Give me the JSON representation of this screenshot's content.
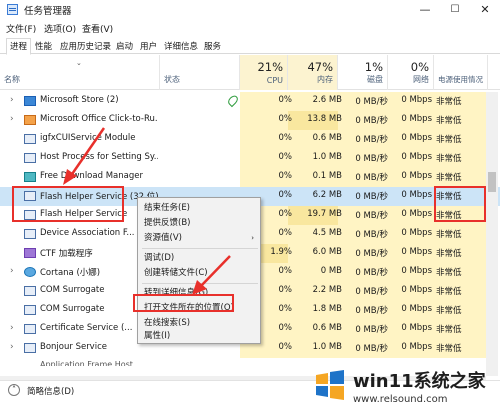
{
  "window": {
    "title": "任务管理器",
    "minimize": "—",
    "maximize": "☐",
    "close": "✕"
  },
  "menubar": [
    "文件(F)",
    "选项(O)",
    "查看(V)"
  ],
  "tabs": [
    "进程",
    "性能",
    "应用历史记录",
    "启动",
    "用户",
    "详细信息",
    "服务"
  ],
  "columns": {
    "name": "名称",
    "status": "状态",
    "cpu": {
      "pct": "21%",
      "label": "CPU"
    },
    "memory": {
      "pct": "47%",
      "label": "内存"
    },
    "disk": {
      "pct": "1%",
      "label": "磁盘"
    },
    "network": {
      "pct": "0%",
      "label": "网络"
    },
    "power": {
      "label": "电源使用情况"
    }
  },
  "rows": [
    {
      "name": "Microsoft Store (2)",
      "cpu": "0%",
      "mem": "2.6 MB",
      "disk": "0 MB/秒",
      "net": "0 Mbps",
      "power": "非常低",
      "expand": "›",
      "icon": "store-icon",
      "leaf": true
    },
    {
      "name": "Microsoft Office Click-to-Ru...",
      "cpu": "0%",
      "mem": "13.8 MB",
      "disk": "0 MB/秒",
      "net": "0 Mbps",
      "power": "非常低",
      "expand": "›",
      "icon": "office-icon"
    },
    {
      "name": "igfxCUIService Module",
      "cpu": "0%",
      "mem": "0.6 MB",
      "disk": "0 MB/秒",
      "net": "0 Mbps",
      "power": "非常低",
      "expand": "",
      "icon": "service-icon"
    },
    {
      "name": "Host Process for Setting Sy...",
      "cpu": "0%",
      "mem": "1.0 MB",
      "disk": "0 MB/秒",
      "net": "0 Mbps",
      "power": "非常低",
      "expand": "",
      "icon": "service-icon"
    },
    {
      "name": "Free Download Manager",
      "cpu": "0%",
      "mem": "0.1 MB",
      "disk": "0 MB/秒",
      "net": "0 Mbps",
      "power": "非常低",
      "expand": "",
      "icon": "download-icon"
    },
    {
      "name": "Flash Helper Service (32 位)",
      "cpu": "0%",
      "mem": "6.2 MB",
      "disk": "0 MB/秒",
      "net": "0 Mbps",
      "power": "非常低",
      "expand": "",
      "icon": "service-icon",
      "selected": true
    },
    {
      "name": "Flash Helper Service",
      "cpu": "0%",
      "mem": "19.7 MB",
      "disk": "0 MB/秒",
      "net": "0 Mbps",
      "power": "非常低",
      "expand": "",
      "icon": "service-icon"
    },
    {
      "name": "Device Association F...",
      "cpu": "0%",
      "mem": "4.5 MB",
      "disk": "0 MB/秒",
      "net": "0 Mbps",
      "power": "非常低",
      "expand": "",
      "icon": "service-icon"
    },
    {
      "name": "CTF 加载程序",
      "cpu": "1.9%",
      "mem": "6.0 MB",
      "disk": "0 MB/秒",
      "net": "0 Mbps",
      "power": "非常低",
      "expand": "",
      "icon": "ctf-icon"
    },
    {
      "name": "Cortana (小娜)",
      "cpu": "0%",
      "mem": "0 MB",
      "disk": "0 MB/秒",
      "net": "0 Mbps",
      "power": "非常低",
      "expand": "›",
      "icon": "cortana-icon"
    },
    {
      "name": "COM Surrogate",
      "cpu": "0%",
      "mem": "2.2 MB",
      "disk": "0 MB/秒",
      "net": "0 Mbps",
      "power": "非常低",
      "expand": "",
      "icon": "service-icon"
    },
    {
      "name": "COM Surrogate",
      "cpu": "0%",
      "mem": "1.8 MB",
      "disk": "0 MB/秒",
      "net": "0 Mbps",
      "power": "非常低",
      "expand": "",
      "icon": "service-icon"
    },
    {
      "name": "Certificate Service (...",
      "cpu": "0%",
      "mem": "0.6 MB",
      "disk": "0 MB/秒",
      "net": "0 Mbps",
      "power": "非常低",
      "expand": "›",
      "icon": "service-icon"
    },
    {
      "name": "Bonjour Service",
      "cpu": "0%",
      "mem": "1.0 MB",
      "disk": "0 MB/秒",
      "net": "0 Mbps",
      "power": "非常低",
      "expand": "›",
      "icon": "service-icon"
    }
  ],
  "context_menu": {
    "items": [
      {
        "label": "结束任务(E)"
      },
      {
        "label": "提供反馈(B)"
      },
      {
        "label": "资源值(V)",
        "submenu": "›"
      },
      {
        "label": "调试(D)"
      },
      {
        "label": "创建转储文件(C)"
      },
      {
        "label": "转到详细信息(G)"
      },
      {
        "label": "打开文件所在的位置(O)"
      },
      {
        "label": "在线搜索(S)"
      },
      {
        "label": "属性(I)"
      }
    ]
  },
  "footer": {
    "less_details": "简略信息(D)"
  },
  "watermark": {
    "title": "win11系统之家",
    "url": "www.relsound.com"
  }
}
